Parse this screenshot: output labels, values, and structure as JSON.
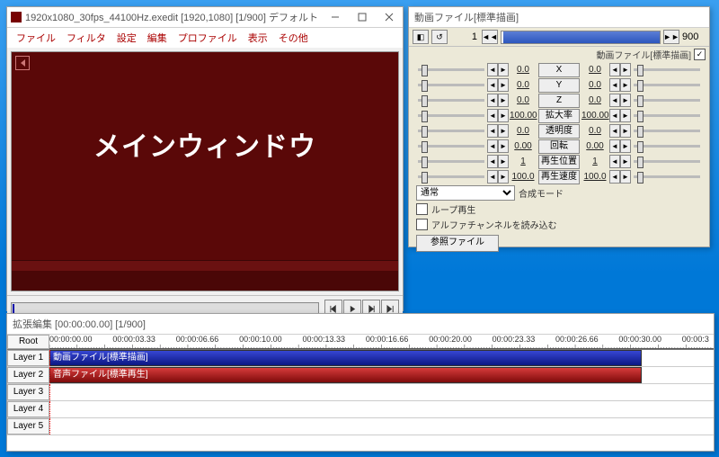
{
  "main": {
    "title": "1920x1080_30fps_44100Hz.exedit [1920,1080] [1/900] デフォルト",
    "menus": [
      "ファイル",
      "フィルタ",
      "設定",
      "編集",
      "プロファイル",
      "表示",
      "その他"
    ],
    "overlay": "メインウィンドウ"
  },
  "prop": {
    "title": "動画ファイル[標準描画]",
    "frame_cur": "1",
    "frame_total": "900",
    "header_label": "動画ファイル[標準描画]",
    "params": [
      {
        "name": "X",
        "l": "0.0",
        "r": "0.0"
      },
      {
        "name": "Y",
        "l": "0.0",
        "r": "0.0"
      },
      {
        "name": "Z",
        "l": "0.0",
        "r": "0.0"
      },
      {
        "name": "拡大率",
        "l": "100.00",
        "r": "100.00"
      },
      {
        "name": "透明度",
        "l": "0.0",
        "r": "0.0"
      },
      {
        "name": "回転",
        "l": "0.00",
        "r": "0.00"
      },
      {
        "name": "再生位置",
        "l": "1",
        "r": "1"
      },
      {
        "name": "再生速度",
        "l": "100.0",
        "r": "100.0"
      }
    ],
    "blend_label": "合成モード",
    "blend_value": "通常",
    "loop": "ループ再生",
    "alpha": "アルファチャンネルを読み込む",
    "ref": "参照ファイル"
  },
  "timeline": {
    "title": "拡張編集 [00:00:00.00] [1/900]",
    "root": "Root",
    "time_labels": [
      "00:00:00.00",
      "00:00:03.33",
      "00:00:06.66",
      "00:00:10.00",
      "00:00:13.33",
      "00:00:16.66",
      "00:00:20.00",
      "00:00:23.33",
      "00:00:26.66",
      "00:00:30.00",
      "00:00:3"
    ],
    "layers": [
      "Layer 1",
      "Layer 2",
      "Layer 3",
      "Layer 4",
      "Layer 5"
    ],
    "clip_video": "動画ファイル[標準描画]",
    "clip_audio": "音声ファイル[標準再生]"
  }
}
